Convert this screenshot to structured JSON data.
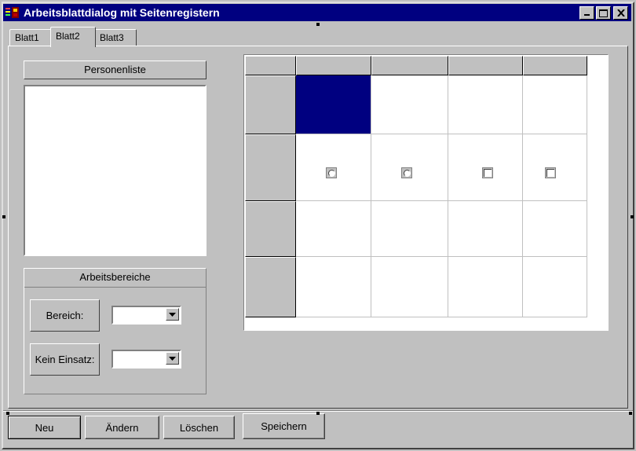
{
  "window": {
    "title": "Arbeitsblattdialog mit Seitenregistern",
    "controls": [
      "minimize-icon",
      "maximize-icon",
      "close-icon"
    ]
  },
  "tabs": [
    {
      "label": "Blatt1",
      "active": false
    },
    {
      "label": "Blatt2",
      "active": true
    },
    {
      "label": "Blatt3",
      "active": false
    }
  ],
  "people": {
    "header": "Personenliste",
    "items": []
  },
  "work_areas": {
    "header": "Arbeitsbereiche",
    "area_label": "Bereich:",
    "area_value": "",
    "no_use_label": "Kein Einsatz:",
    "no_use_value": ""
  },
  "grid": {
    "columns": 4,
    "rows": 4,
    "selected_cell": [
      0,
      0
    ],
    "controls_row": 1,
    "controls": [
      "radio",
      "radio",
      "checkbox",
      "checkbox"
    ],
    "selection_color": "#000080"
  },
  "buttons": {
    "new": "Neu",
    "edit": "Ändern",
    "delete": "Löschen",
    "save": "Speichern"
  }
}
